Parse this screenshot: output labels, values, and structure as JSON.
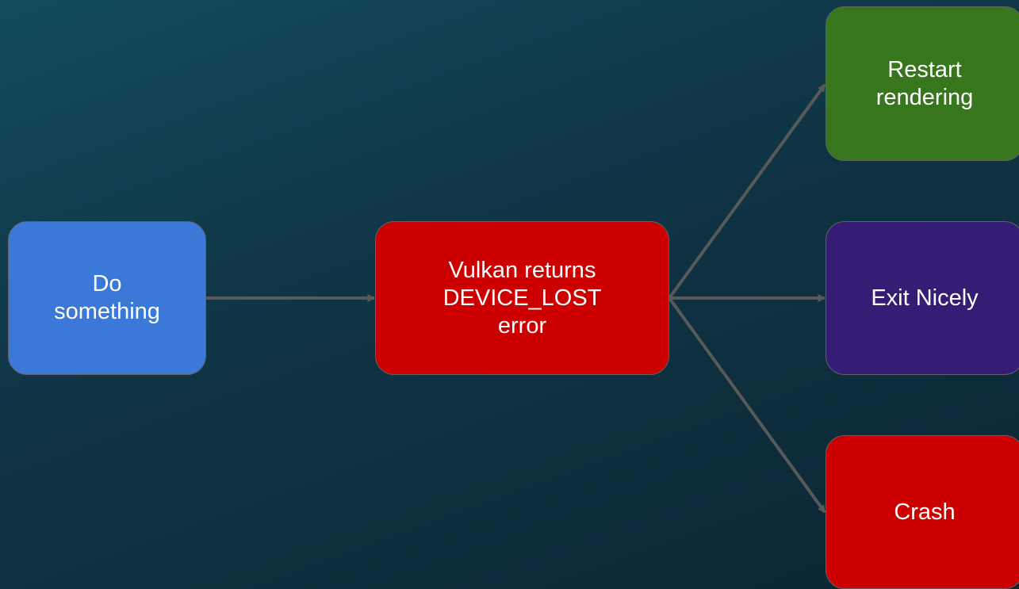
{
  "nodes": {
    "start": {
      "line1": "Do",
      "line2": "something",
      "color": "#3c78d8"
    },
    "error": {
      "line1": "Vulkan returns",
      "line2": "DEVICE_LOST",
      "line3": "error",
      "color": "#cc0000"
    },
    "restart": {
      "line1": "Restart",
      "line2": "rendering",
      "color": "#38761d"
    },
    "exit": {
      "label": "Exit Nicely",
      "color": "#351c75"
    },
    "crash": {
      "label": "Crash",
      "color": "#cc0000"
    }
  },
  "edges": [
    {
      "from": "start",
      "to": "error"
    },
    {
      "from": "error",
      "to": "restart"
    },
    {
      "from": "error",
      "to": "exit"
    },
    {
      "from": "error",
      "to": "crash"
    }
  ],
  "colors": {
    "connector": "#595959",
    "node_border": "#5f6368",
    "text": "#ffffff"
  }
}
